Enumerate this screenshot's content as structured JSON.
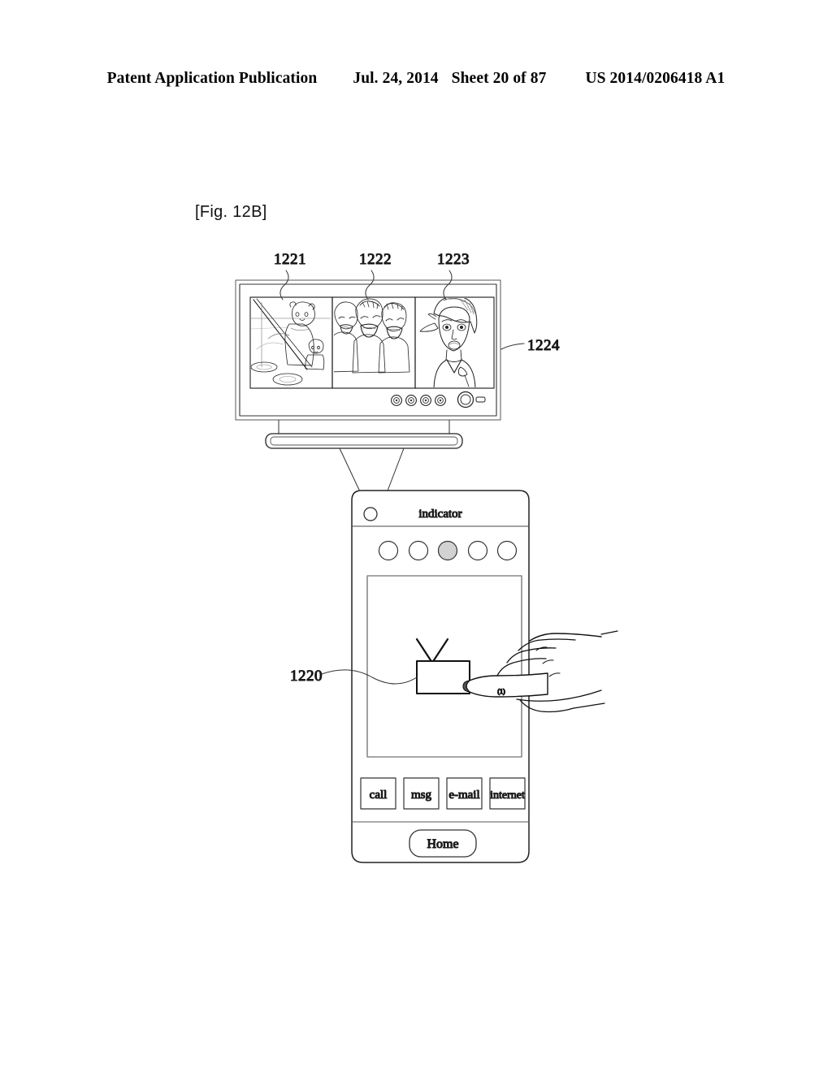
{
  "header": {
    "publication": "Patent Application Publication",
    "date": "Jul. 24, 2014",
    "sheet": "Sheet 20 of 87",
    "patent_number": "US 2014/0206418 A1"
  },
  "figure": {
    "label": "[Fig. 12B]",
    "reference_numerals": {
      "panel_left": "1221",
      "panel_middle": "1222",
      "panel_right": "1223",
      "television": "1224",
      "tv_icon_on_phone": "1220"
    }
  },
  "television": {
    "panels": [
      {
        "id": "1221",
        "description": "bears-ice-fishing-scene"
      },
      {
        "id": "1222",
        "description": "three-laughing-people"
      },
      {
        "id": "1223",
        "description": "portrait-of-person"
      }
    ],
    "controls": {
      "small_buttons": 4,
      "power_knob": "power-knob",
      "indicator_slot": "indicator-slot"
    }
  },
  "phone": {
    "indicator_label": "indicator",
    "camera": "front-camera",
    "page_dots": {
      "count": 5,
      "active_index": 2
    },
    "dragged_icon": {
      "name": "tv-icon",
      "numeral": "1220"
    },
    "hand": {
      "gesture": "index-finger-drag",
      "nail_mark": "(1)"
    },
    "app_buttons": [
      "call",
      "msg",
      "e-mail",
      "internet"
    ],
    "home_button": "Home"
  },
  "colors": {
    "ink": "#111111",
    "line": "#2b2b2b",
    "light_line": "#8a8a8a",
    "fill_dot": "#cfcfcf",
    "paper": "#ffffff"
  }
}
